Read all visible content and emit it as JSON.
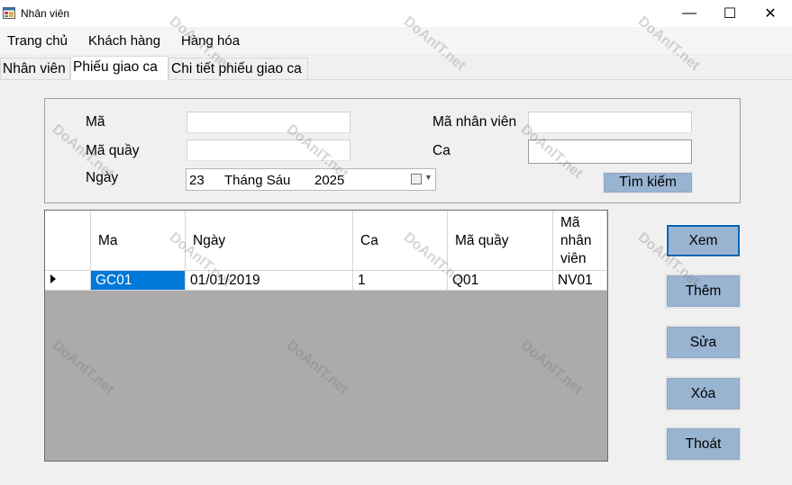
{
  "window": {
    "title": "Nhân viên",
    "minimize_glyph": "—",
    "maximize_glyph": "☐",
    "close_glyph": "✕"
  },
  "menu": [
    "Trang chủ",
    "Khách hàng",
    "Hàng hóa"
  ],
  "tabs": [
    "Nhân viên",
    "Phiếu giao ca",
    "Chi tiết phiếu giao ca"
  ],
  "active_tab": "Phiếu giao ca",
  "form": {
    "ma_label": "Mã",
    "ma_value": "",
    "ma_quay_label": "Mã quầy",
    "ma_quay_value": "",
    "ngay_label": "Ngày",
    "ngay_day": "23",
    "ngay_month": "Tháng Sáu",
    "ngay_year": "2025",
    "ma_nhan_vien_label": "Mã nhân viên",
    "ma_nhan_vien_value": "",
    "ca_label": "Ca",
    "ca_value": "",
    "search_button": "Tìm kiếm"
  },
  "grid": {
    "columns": [
      "Ma",
      "Ngày",
      "Ca",
      "Mã quầy",
      "Mã nhân viên"
    ],
    "rows": [
      [
        "GC01",
        "01/01/2019",
        "1",
        "Q01",
        "NV01"
      ]
    ]
  },
  "buttons": {
    "xem": "Xem",
    "them": "Thêm",
    "sua": "Sửa",
    "xoa": "Xóa",
    "thoat": "Thoát"
  },
  "watermark": "DoAnIT.net",
  "colors": {
    "button_bg": "#99b4d1",
    "selection": "#0078d7",
    "grid_bg": "#ababab"
  }
}
